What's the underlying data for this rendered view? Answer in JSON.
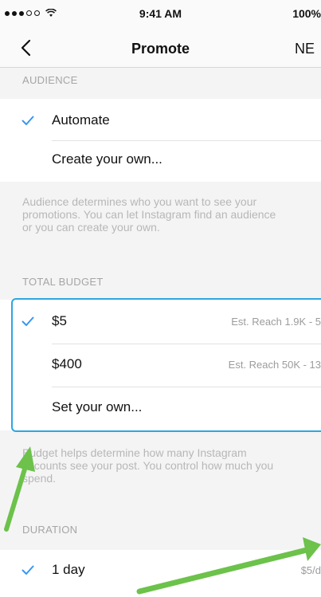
{
  "status_bar": {
    "time": "9:41 AM",
    "battery": "100%"
  },
  "nav": {
    "title": "Promote",
    "next_label": "NE"
  },
  "audience": {
    "header": "AUDIENCE",
    "options": [
      {
        "label": "Automate",
        "selected": true
      },
      {
        "label": "Create your own...",
        "selected": false
      }
    ],
    "help_lines": [
      "Audience determines who you want to see your",
      "promotions. You can let Instagram find an audience",
      "or you can create your own."
    ]
  },
  "budget": {
    "header": "TOTAL BUDGET",
    "options": [
      {
        "label": "$5",
        "reach": "Est. Reach 1.9K - 5",
        "selected": true
      },
      {
        "label": "$400",
        "reach": "Est. Reach 50K - 13",
        "selected": false
      },
      {
        "label": "Set your own...",
        "reach": "",
        "selected": false
      }
    ],
    "help_lines": [
      "Budget helps determine how many Instagram",
      "accounts see your post. You control how much you",
      "spend."
    ]
  },
  "duration": {
    "header": "DURATION",
    "options": [
      {
        "label": "1 day",
        "price": "$5/d",
        "selected": true
      }
    ]
  },
  "colors": {
    "accent_check": "#3897f0",
    "highlight_border": "#2fa6e0",
    "arrow_green": "#6cc24a"
  }
}
